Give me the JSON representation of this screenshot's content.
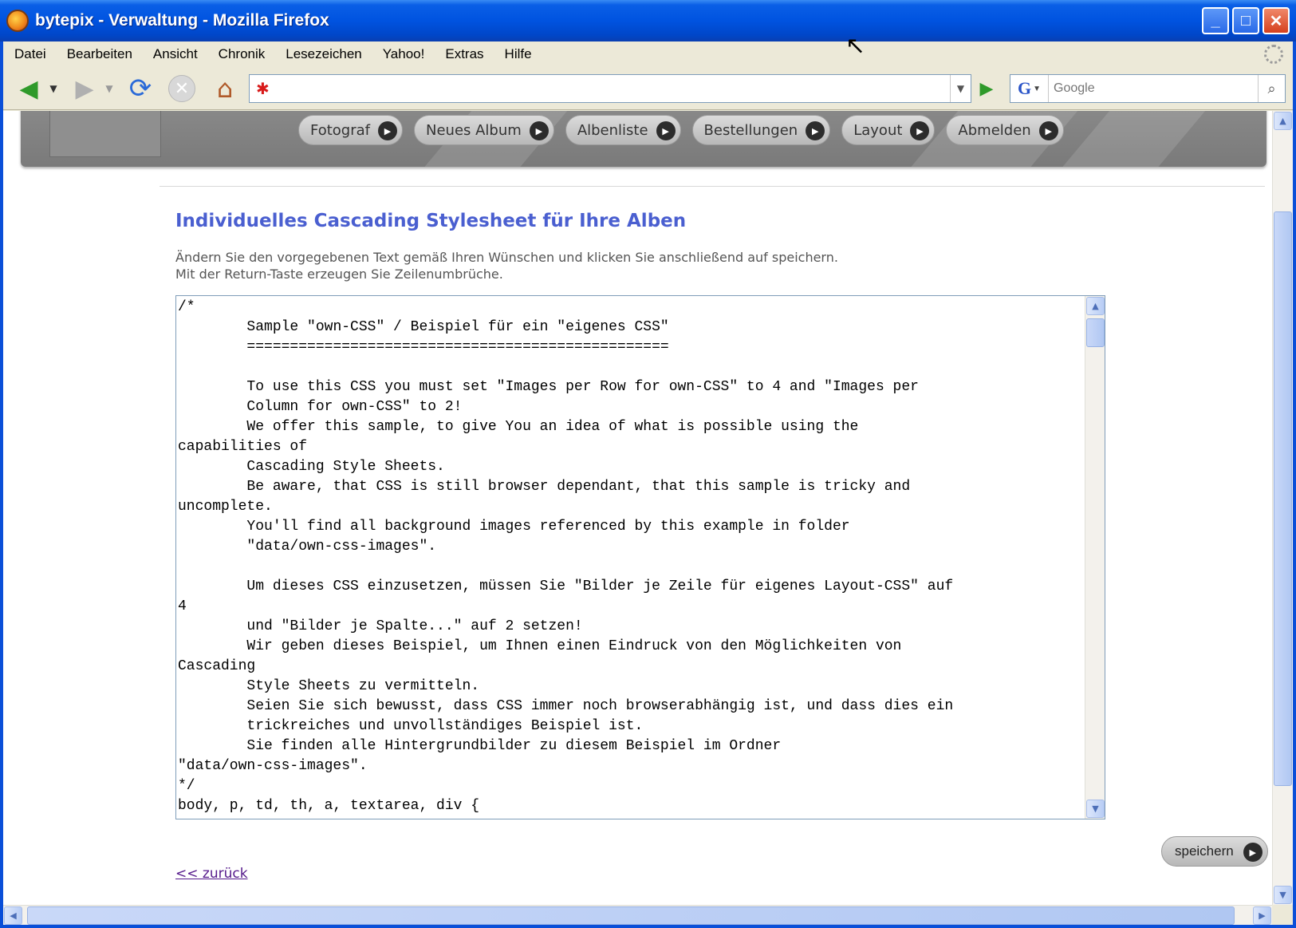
{
  "window": {
    "title": "bytepix - Verwaltung - Mozilla Firefox",
    "minimize": "_",
    "maximize": "□",
    "close": "✕"
  },
  "menu": [
    "Datei",
    "Bearbeiten",
    "Ansicht",
    "Chronik",
    "Lesezeichen",
    "Yahoo!",
    "Extras",
    "Hilfe"
  ],
  "toolbar": {
    "url": "",
    "search_placeholder": "Google",
    "search_engine": "G"
  },
  "icons": {
    "back": "back-arrow-icon",
    "forward": "forward-arrow-icon",
    "reload": "reload-icon",
    "stop": "stop-icon",
    "home": "home-icon",
    "go": "go-arrow-icon",
    "search": "magnifier-icon"
  },
  "nav": [
    "Fotograf",
    "Neues Album",
    "Albenliste",
    "Bestellungen",
    "Layout",
    "Abmelden"
  ],
  "page": {
    "title": "Individuelles Cascading Stylesheet für Ihre Alben",
    "instruction_1": "Ändern Sie den vorgegebenen Text gemäß Ihren Wünschen und klicken Sie anschließend auf speichern.",
    "instruction_2": "Mit der Return-Taste erzeugen Sie Zeilenumbrüche.",
    "css_content": "/*\n        Sample \"own-CSS\" / Beispiel für ein \"eigenes CSS\"\n        =================================================\n\n        To use this CSS you must set \"Images per Row for own-CSS\" to 4 and \"Images per\n        Column for own-CSS\" to 2!\n        We offer this sample, to give You an idea of what is possible using the\ncapabilities of\n        Cascading Style Sheets.\n        Be aware, that CSS is still browser dependant, that this sample is tricky and\nuncomplete.\n        You'll find all background images referenced by this example in folder\n        \"data/own-css-images\".\n\n        Um dieses CSS einzusetzen, müssen Sie \"Bilder je Zeile für eigenes Layout-CSS\" auf\n4\n        und \"Bilder je Spalte...\" auf 2 setzen!\n        Wir geben dieses Beispiel, um Ihnen einen Eindruck von den Möglichkeiten von\nCascading\n        Style Sheets zu vermitteln.\n        Seien Sie sich bewusst, dass CSS immer noch browserabhängig ist, und dass dies ein\n        trickreiches und unvollständiges Beispiel ist.\n        Sie finden alle Hintergrundbilder zu diesem Beispiel im Ordner\n\"data/own-css-images\".\n*/\nbody, p, td, th, a, textarea, div {",
    "save_label": "speichern",
    "back_label": "<< zurück"
  },
  "colors": {
    "title_blue": "#4a5fd0",
    "xp_titlebar": "#0053e0",
    "link_visited": "#551a8b"
  }
}
